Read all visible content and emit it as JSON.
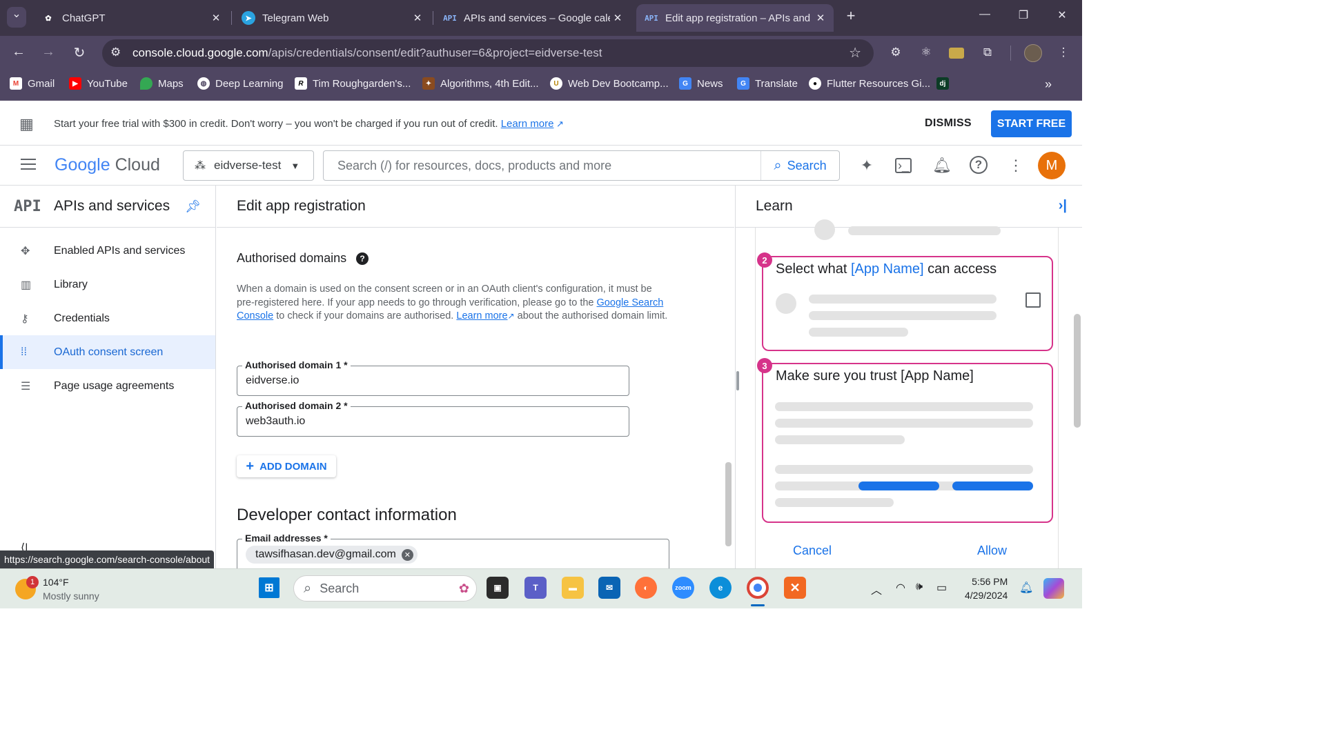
{
  "browser": {
    "tabs": [
      {
        "title": "ChatGPT",
        "icon": "chatgpt-icon"
      },
      {
        "title": "Telegram Web",
        "icon": "telegram-icon"
      },
      {
        "title": "APIs and services – Google cale",
        "icon": "api-icon"
      },
      {
        "title": "Edit app registration – APIs and",
        "icon": "api-icon"
      }
    ],
    "url_host": "console.cloud.google.com",
    "url_path": "/apis/credentials/consent/edit?authuser=6&project=eidverse-test",
    "bookmarks": [
      "Gmail",
      "YouTube",
      "Maps",
      "Deep Learning",
      "Tim Roughgarden's...",
      "Algorithms, 4th Edit...",
      "Web Dev Bootcamp...",
      "News",
      "Translate",
      "Flutter Resources Gi...",
      "dj"
    ]
  },
  "promo": {
    "text": "Start your free trial with $300 in credit. Don't worry – you won't be charged if you run out of credit.",
    "learn_more": "Learn more",
    "dismiss": "DISMISS",
    "start_free": "START FREE"
  },
  "header": {
    "logo_google": "Google",
    "logo_cloud": "Cloud",
    "project": "eidverse-test",
    "search_placeholder": "Search (/) for resources, docs, products and more",
    "search_button": "Search",
    "avatar_letter": "M"
  },
  "sidebar": {
    "badge": "API",
    "title": "APIs and services",
    "items": [
      {
        "label": "Enabled APIs and services",
        "icon": "enabled-apis-icon"
      },
      {
        "label": "Library",
        "icon": "library-icon"
      },
      {
        "label": "Credentials",
        "icon": "key-icon"
      },
      {
        "label": "OAuth consent screen",
        "icon": "consent-icon",
        "selected": true
      },
      {
        "label": "Page usage agreements",
        "icon": "settings-list-icon"
      }
    ]
  },
  "main": {
    "title": "Edit app registration",
    "section_title": "Authorised domains",
    "desc_1": "When a domain is used on the consent screen or in an OAuth client's configuration, it must be pre-registered here. If your app needs to go through verification, please go to the",
    "desc_link1": "Google Search Console",
    "desc_2": "to check if your domains are authorised.",
    "desc_link2": "Learn more",
    "desc_3": "about the authorised domain limit.",
    "domain1_label": "Authorised domain 1 *",
    "domain1_value": "eidverse.io",
    "domain2_label": "Authorised domain 2 *",
    "domain2_value": "web3auth.io",
    "add_domain": "ADD DOMAIN",
    "dev_title": "Developer contact information",
    "email_label": "Email addresses *",
    "email_chip": "tawsifhasan.dev@gmail.com"
  },
  "learn": {
    "title": "Learn",
    "card2_num": "2",
    "card2_title_a": "Select what",
    "card2_title_hl": "[App Name]",
    "card2_title_b": "can access",
    "card3_num": "3",
    "card3_title": "Make sure you trust [App Name]",
    "cancel": "Cancel",
    "allow": "Allow"
  },
  "status_tooltip": "https://search.google.com/search-console/about",
  "taskbar": {
    "weather_temp": "104°F",
    "weather_desc": "Mostly sunny",
    "weather_badge": "1",
    "search": "Search",
    "time": "5:56 PM",
    "date": "4/29/2024"
  },
  "colors": {
    "accent": "#1a73e8",
    "browser_frame": "#4f4662",
    "highlight_border": "#d6338a",
    "avatar": "#e8710a"
  }
}
